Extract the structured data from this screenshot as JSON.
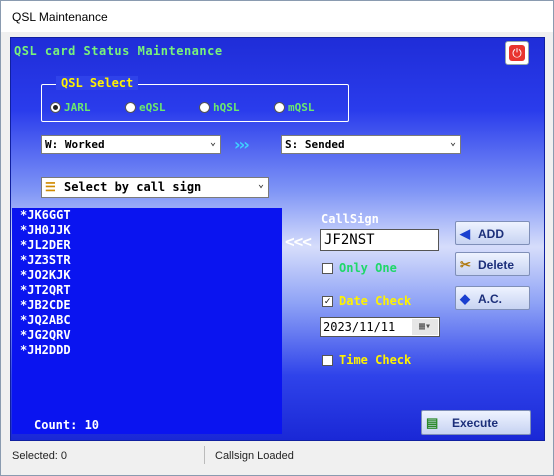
{
  "window": {
    "title": "QSL Maintenance"
  },
  "header": {
    "title": "QSL card Status Maintenance"
  },
  "qsl_select": {
    "legend": "QSL Select",
    "options": [
      {
        "label": "JARL",
        "selected": true
      },
      {
        "label": "eQSL",
        "selected": false
      },
      {
        "label": "hQSL",
        "selected": false
      },
      {
        "label": "mQSL",
        "selected": false
      }
    ]
  },
  "from_status": "W: Worked",
  "arrow_right": "›››",
  "to_status": "S: Sended",
  "select_mode": "Select by call sign",
  "callsign_list": [
    "*JK6GGT",
    "*JH0JJK",
    "*JL2DER",
    "*JZ3STR",
    "*JO2KJK",
    "*JT2QRT",
    "*JB2CDE",
    "*JQ2ABC",
    "*JG2QRV",
    "*JH2DDD"
  ],
  "callsign": {
    "label": "CallSign",
    "value": "JF2NST",
    "back_arrow": "<<<"
  },
  "buttons": {
    "add": "ADD",
    "delete": "Delete",
    "ac": "A.C.",
    "execute": "Execute"
  },
  "only_one": {
    "label": "Only One",
    "checked": false
  },
  "date_check": {
    "label": "Date Check",
    "checked": true,
    "value": "2023/11/11"
  },
  "time_check": {
    "label": "Time Check",
    "checked": false
  },
  "count_label": "Count: 10",
  "status": {
    "left": "Selected: 0",
    "right": "Callsign Loaded"
  },
  "colors": {
    "accent_green": "#79f27a",
    "legend_yellow": "#fff200",
    "list_bg": "#0a14f0"
  }
}
